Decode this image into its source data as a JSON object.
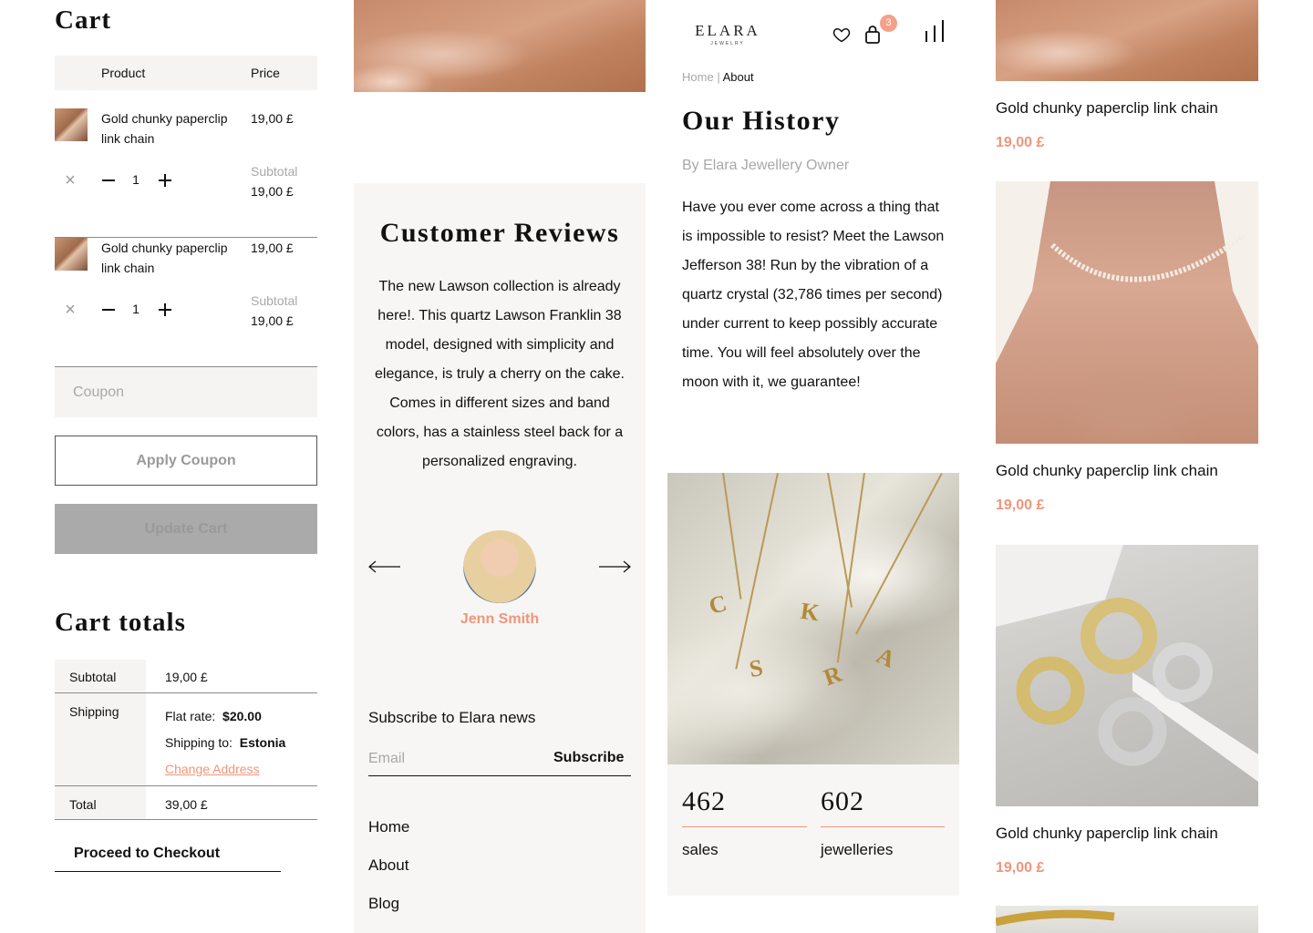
{
  "cart": {
    "title": "Cart",
    "columns": {
      "product": "Product",
      "price": "Price"
    },
    "items": [
      {
        "name": "Gold chunky paperclip link chain",
        "price": "19,00 £",
        "quantity": "1",
        "subtotal_label": "Subtotal",
        "subtotal": "19,00 £"
      },
      {
        "name": "Gold chunky paperclip link chain",
        "price": "19,00 £",
        "quantity": "1",
        "subtotal_label": "Subtotal",
        "subtotal": "19,00 £"
      }
    ],
    "coupon_placeholder": "Coupon",
    "apply_coupon_label": "Apply Coupon",
    "update_cart_label": "Update Cart"
  },
  "totals": {
    "title": "Cart totals",
    "subtotal_label": "Subtotal",
    "subtotal_value": "19,00 £",
    "shipping_label": "Shipping",
    "flat_rate_label": "Flat rate:",
    "flat_rate_value": "$20.00",
    "shipping_to_label": "Shipping to:",
    "shipping_to_value": "Estonia",
    "change_address_label": "Change Address",
    "total_label": "Total",
    "total_value": "39,00 £",
    "checkout_label": "Proceed to Checkout"
  },
  "reviews": {
    "title": "Customer Reviews",
    "text": "The new Lawson collection is already here!. This quartz Lawson Franklin 38 model, designed with simplicity and elegance, is truly a cherry on the cake. Comes in different sizes and band colors, has a stainless steel back for a personalized engraving.",
    "reviewer": "Jenn Smith"
  },
  "newsletter": {
    "label": "Subscribe to Elara news",
    "email_placeholder": "Email",
    "subscribe_label": "Subscribe"
  },
  "footer_nav": [
    "Home",
    "About",
    "Blog"
  ],
  "header": {
    "logo": "ELARA",
    "logo_sub": "JEWELRY",
    "cart_count": "3"
  },
  "about": {
    "breadcrumb_home": "Home",
    "breadcrumb_sep": "|",
    "breadcrumb_current": "About",
    "title": "Our History",
    "byline": "By Elara Jewellery Owner",
    "text": "Have you ever come across a thing that is impossible to resist? Meet the Lawson Jefferson 38! Run by the vibration of a quartz crystal (32,786 times per second) under current to keep possibly accurate time. You will feel absolutely over the moon with it, we guarantee!",
    "pendant_letters": [
      "C",
      "K",
      "S",
      "R",
      "A"
    ],
    "stats": [
      {
        "value": "462",
        "label": "sales"
      },
      {
        "value": "602",
        "label": "jewelleries"
      }
    ]
  },
  "products": [
    {
      "name": "Gold chunky paperclip link chain",
      "price": "19,00 £"
    },
    {
      "name": "Gold chunky paperclip link chain",
      "price": "19,00 £"
    },
    {
      "name": "Gold chunky paperclip link chain",
      "price": "19,00 £"
    }
  ],
  "colors": {
    "accent": "#f0957a",
    "panel_bg": "#f7f6f4",
    "muted_text": "#a8a8a8",
    "badge_bg": "#f4a08a"
  }
}
